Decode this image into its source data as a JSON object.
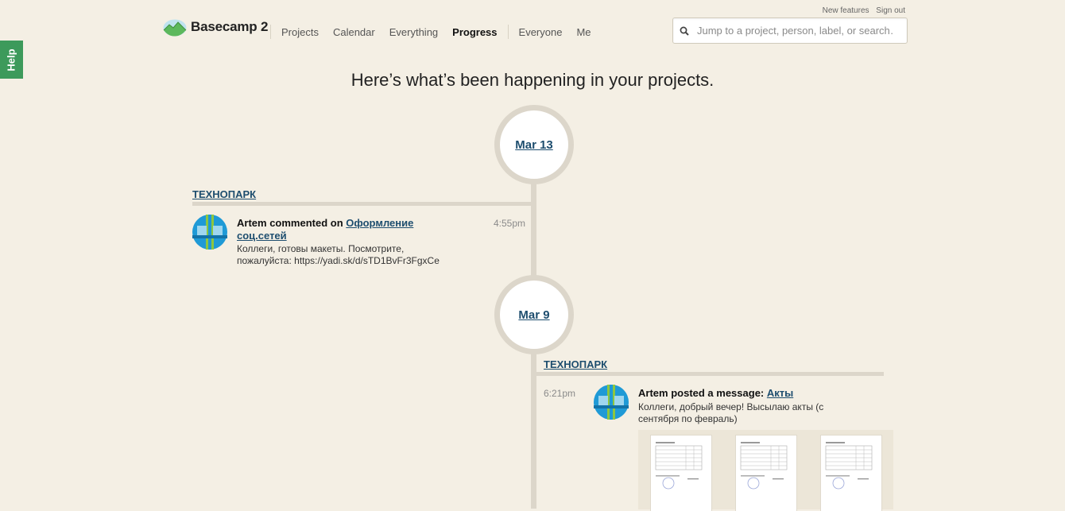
{
  "help": {
    "label": "Help"
  },
  "top_links": {
    "new_features": "New features",
    "sign_out": "Sign out"
  },
  "logo": {
    "text": "Basecamp 2"
  },
  "nav": {
    "projects": "Projects",
    "calendar": "Calendar",
    "everything": "Everything",
    "progress": "Progress",
    "everyone": "Everyone",
    "me": "Me"
  },
  "search": {
    "placeholder": "Jump to a project, person, label, or search…"
  },
  "headline": "Here’s what’s been happening in your projects.",
  "days": [
    {
      "date": "Mar 13",
      "project": "ТЕХНОПАРК",
      "event": {
        "author": "Artem",
        "action": "commented on",
        "link_line1": "Оформление",
        "link_line2": "соц.сетей",
        "time": "4:55pm",
        "body_line1": "Коллеги, готовы макеты. Посмотрите,",
        "body_line2": "пожалуйста: https://yadi.sk/d/sTD1BvFr3FgxCe"
      }
    },
    {
      "date": "Mar 9",
      "project": "ТЕХНОПАРК",
      "event": {
        "author": "Artem",
        "action": "posted a message:",
        "link": "Акты",
        "time": "6:21pm",
        "body_line1": "Коллеги, добрый вечер! Высылаю акты (с",
        "body_line2": "сентября по февраль)"
      }
    }
  ],
  "colors": {
    "background": "#f4efe4",
    "link": "#1d4d6e",
    "timeline": "#dcd6ca",
    "help_tab": "#3d9a5b"
  }
}
